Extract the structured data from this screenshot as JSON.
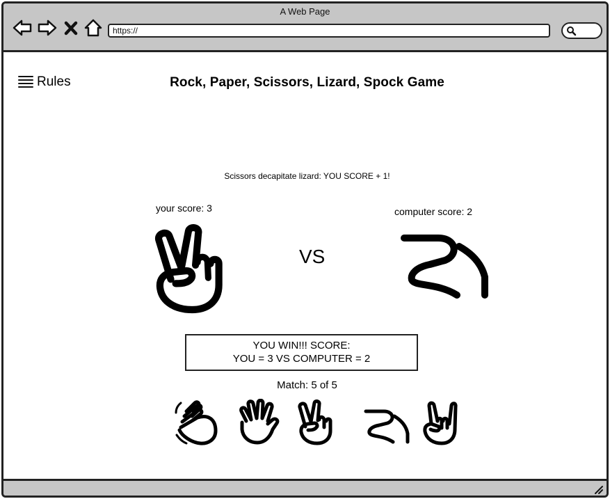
{
  "browser": {
    "window_title": "A Web Page",
    "url": "https://",
    "icons": [
      "back-arrow-icon",
      "forward-arrow-icon",
      "close-x-icon",
      "home-icon",
      "search-icon",
      "resize-grip-icon"
    ]
  },
  "menu": {
    "label": "Rules",
    "icon": "hamburger-menu-icon"
  },
  "page": {
    "title": "Rock, Paper, Scissors, Lizard, Spock Game"
  },
  "round": {
    "result_message": "Scissors decapitate lizard: YOU SCORE + 1!",
    "player_score_label": "your score: 3",
    "computer_score_label": "computer score: 2",
    "vs_label": "VS",
    "player_choice_icon": "scissors-hand-icon",
    "computer_choice_icon": "lizard-hand-icon"
  },
  "summary": {
    "line1": "YOU WIN!!!  SCORE:",
    "line2": "YOU = 3 VS COMPUTER = 2"
  },
  "match": {
    "label": "Match: 5 of 5"
  },
  "choices": [
    {
      "name": "rock",
      "icon": "rock-hand-icon"
    },
    {
      "name": "paper",
      "icon": "paper-hand-icon"
    },
    {
      "name": "scissors",
      "icon": "scissors-hand-icon"
    },
    {
      "name": "lizard",
      "icon": "lizard-hand-icon"
    },
    {
      "name": "spock",
      "icon": "spock-hand-icon"
    }
  ]
}
